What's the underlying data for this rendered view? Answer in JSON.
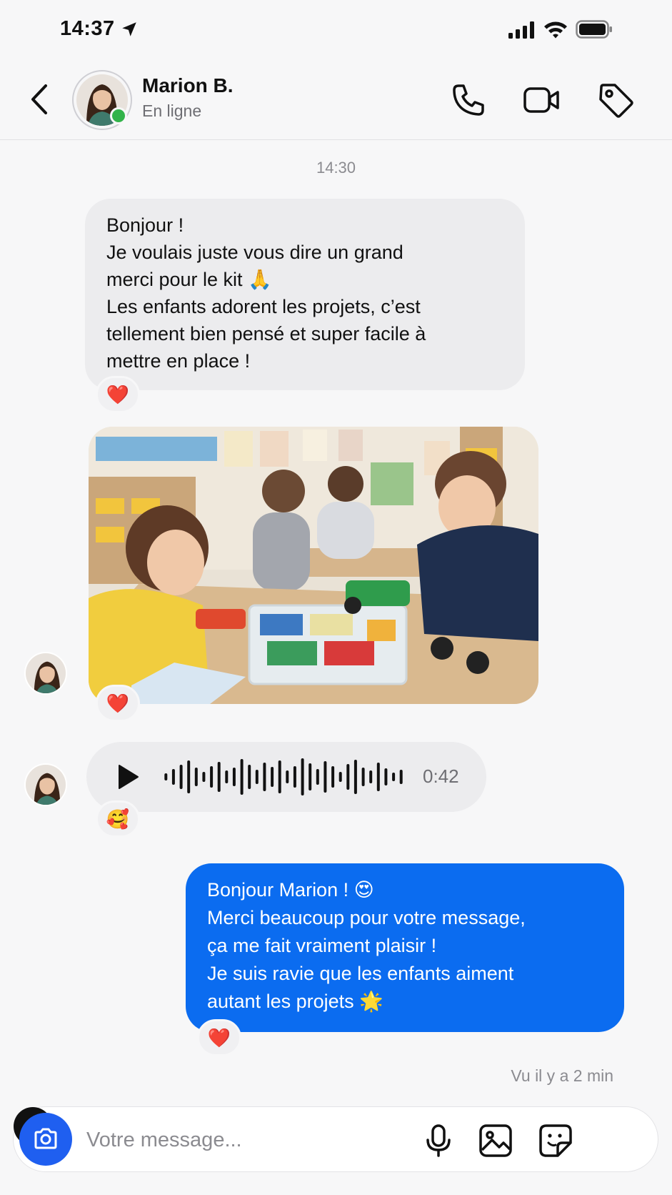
{
  "status_bar": {
    "time": "14:37"
  },
  "header": {
    "contact_name": "Marion B.",
    "contact_status": "En ligne"
  },
  "conversation": {
    "timestamp": "14:30",
    "incoming_text": {
      "lines": [
        "Bonjour !",
        "Je voulais juste vous dire un grand",
        "merci pour le kit 🙏",
        "Les enfants adorent les projets, c’est",
        "tellement bien pensé et super facile à",
        "mettre en place !"
      ],
      "reaction": "❤️"
    },
    "incoming_photo": {
      "reaction": "❤️"
    },
    "incoming_audio": {
      "duration": "0:42",
      "reaction": "🥰"
    },
    "outgoing_text": {
      "lines": [
        "Bonjour Marion ! 😍",
        "Merci beaucoup pour votre message,",
        "ça me fait vraiment plaisir !",
        "Je suis ravie que les enfants aiment",
        "autant les projets 🌟"
      ],
      "reaction": "❤️"
    },
    "seen_status": "Vu il y a 2 min"
  },
  "composer": {
    "placeholder": "Votre message..."
  },
  "colors": {
    "outgoing_bubble": "#0b6cf0",
    "incoming_bubble": "#ececee",
    "online_dot": "#32b34a",
    "camera_button": "#1f5ff0"
  }
}
